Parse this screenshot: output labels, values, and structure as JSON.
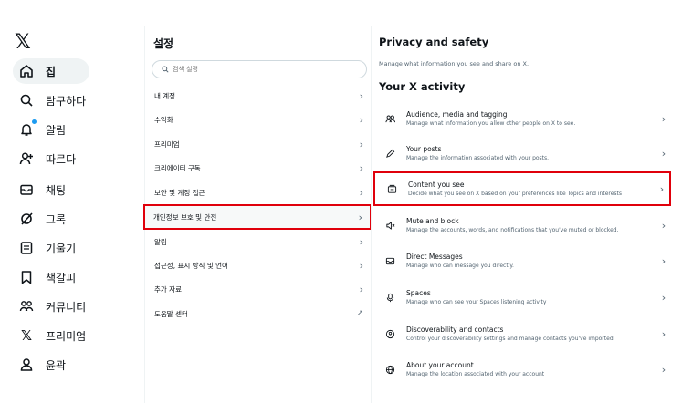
{
  "nav": {
    "logo": "𝕏",
    "items": [
      {
        "label": "집",
        "icon": "home-icon"
      },
      {
        "label": "탐구하다",
        "icon": "search-icon"
      },
      {
        "label": "알림",
        "icon": "bell-icon"
      },
      {
        "label": "따르다",
        "icon": "follow-icon"
      },
      {
        "label": "채팅",
        "icon": "mail-icon"
      },
      {
        "label": "그록",
        "icon": "grok-icon"
      },
      {
        "label": "기울기",
        "icon": "list-icon"
      },
      {
        "label": "책갈피",
        "icon": "bookmark-icon"
      },
      {
        "label": "커뮤니티",
        "icon": "communities-icon"
      },
      {
        "label": "프리미엄",
        "icon": "x-icon"
      },
      {
        "label": "윤곽",
        "icon": "profile-icon"
      }
    ]
  },
  "settings": {
    "title": "설정",
    "search_placeholder": "검색 설정",
    "items": [
      {
        "label": "내 계정",
        "trail": "›"
      },
      {
        "label": "수익화",
        "trail": "›"
      },
      {
        "label": "프리미엄",
        "trail": "›"
      },
      {
        "label": "크리에이터 구독",
        "trail": "›"
      },
      {
        "label": "보안 및 계정 접근",
        "trail": "›"
      },
      {
        "label": "개인정보 보호 및 안전",
        "trail": "›"
      },
      {
        "label": "알림",
        "trail": "›"
      },
      {
        "label": "접근성, 표시 방식 및 언어",
        "trail": "›"
      },
      {
        "label": "추가 자료",
        "trail": "›"
      },
      {
        "label": "도움말 센터",
        "trail": "↗"
      }
    ]
  },
  "detail": {
    "title": "Privacy and safety",
    "subtitle": "Manage what information you see and share on X.",
    "section_title": "Your X activity",
    "rows": [
      {
        "title": "Audience, media and tagging",
        "desc": "Manage what information you allow other people on X to see.",
        "icon": "people-icon"
      },
      {
        "title": "Your posts",
        "desc": "Manage the information associated with your posts.",
        "icon": "pen-icon"
      },
      {
        "title": "Content you see",
        "desc": "Decide what you see on X based on your preferences like Topics and interests",
        "icon": "content-icon"
      },
      {
        "title": "Mute and block",
        "desc": "Manage the accounts, words, and notifications that you've muted or blocked.",
        "icon": "mute-icon"
      },
      {
        "title": "Direct Messages",
        "desc": "Manage who can message you directly.",
        "icon": "mail-icon"
      },
      {
        "title": "Spaces",
        "desc": "Manage who can see your Spaces listening activity",
        "icon": "spaces-icon"
      },
      {
        "title": "Discoverability and contacts",
        "desc": "Control your discoverability settings and manage contacts you've imported.",
        "icon": "discover-icon"
      },
      {
        "title": "About your account",
        "desc": "Manage the location associated with your account",
        "icon": "globe-icon"
      }
    ],
    "chevron": "›"
  },
  "colors": {
    "accent": "#1d9bf0",
    "highlight": "#e0000b",
    "muted": "#536471"
  }
}
